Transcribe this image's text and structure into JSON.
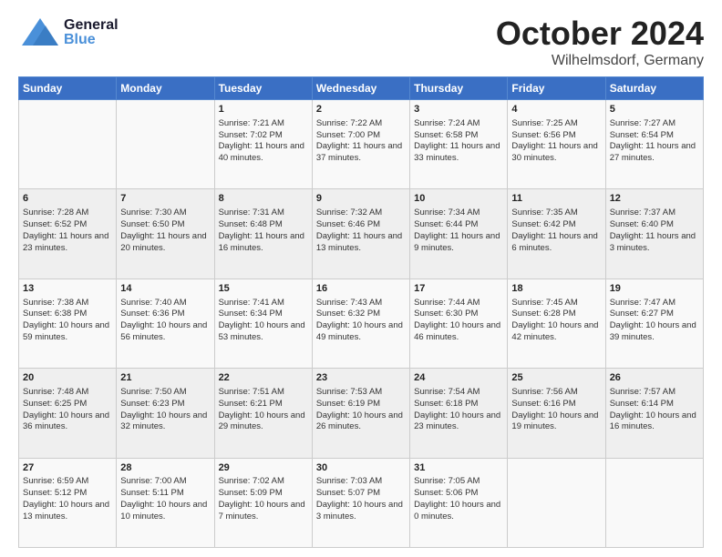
{
  "header": {
    "title": "October 2024",
    "subtitle": "Wilhelmsdorf, Germany",
    "logo_general": "General",
    "logo_blue": "Blue"
  },
  "weekdays": [
    "Sunday",
    "Monday",
    "Tuesday",
    "Wednesday",
    "Thursday",
    "Friday",
    "Saturday"
  ],
  "weeks": [
    [
      {
        "day": "",
        "content": ""
      },
      {
        "day": "",
        "content": ""
      },
      {
        "day": "1",
        "content": "Sunrise: 7:21 AM\nSunset: 7:02 PM\nDaylight: 11 hours and 40 minutes."
      },
      {
        "day": "2",
        "content": "Sunrise: 7:22 AM\nSunset: 7:00 PM\nDaylight: 11 hours and 37 minutes."
      },
      {
        "day": "3",
        "content": "Sunrise: 7:24 AM\nSunset: 6:58 PM\nDaylight: 11 hours and 33 minutes."
      },
      {
        "day": "4",
        "content": "Sunrise: 7:25 AM\nSunset: 6:56 PM\nDaylight: 11 hours and 30 minutes."
      },
      {
        "day": "5",
        "content": "Sunrise: 7:27 AM\nSunset: 6:54 PM\nDaylight: 11 hours and 27 minutes."
      }
    ],
    [
      {
        "day": "6",
        "content": "Sunrise: 7:28 AM\nSunset: 6:52 PM\nDaylight: 11 hours and 23 minutes."
      },
      {
        "day": "7",
        "content": "Sunrise: 7:30 AM\nSunset: 6:50 PM\nDaylight: 11 hours and 20 minutes."
      },
      {
        "day": "8",
        "content": "Sunrise: 7:31 AM\nSunset: 6:48 PM\nDaylight: 11 hours and 16 minutes."
      },
      {
        "day": "9",
        "content": "Sunrise: 7:32 AM\nSunset: 6:46 PM\nDaylight: 11 hours and 13 minutes."
      },
      {
        "day": "10",
        "content": "Sunrise: 7:34 AM\nSunset: 6:44 PM\nDaylight: 11 hours and 9 minutes."
      },
      {
        "day": "11",
        "content": "Sunrise: 7:35 AM\nSunset: 6:42 PM\nDaylight: 11 hours and 6 minutes."
      },
      {
        "day": "12",
        "content": "Sunrise: 7:37 AM\nSunset: 6:40 PM\nDaylight: 11 hours and 3 minutes."
      }
    ],
    [
      {
        "day": "13",
        "content": "Sunrise: 7:38 AM\nSunset: 6:38 PM\nDaylight: 10 hours and 59 minutes."
      },
      {
        "day": "14",
        "content": "Sunrise: 7:40 AM\nSunset: 6:36 PM\nDaylight: 10 hours and 56 minutes."
      },
      {
        "day": "15",
        "content": "Sunrise: 7:41 AM\nSunset: 6:34 PM\nDaylight: 10 hours and 53 minutes."
      },
      {
        "day": "16",
        "content": "Sunrise: 7:43 AM\nSunset: 6:32 PM\nDaylight: 10 hours and 49 minutes."
      },
      {
        "day": "17",
        "content": "Sunrise: 7:44 AM\nSunset: 6:30 PM\nDaylight: 10 hours and 46 minutes."
      },
      {
        "day": "18",
        "content": "Sunrise: 7:45 AM\nSunset: 6:28 PM\nDaylight: 10 hours and 42 minutes."
      },
      {
        "day": "19",
        "content": "Sunrise: 7:47 AM\nSunset: 6:27 PM\nDaylight: 10 hours and 39 minutes."
      }
    ],
    [
      {
        "day": "20",
        "content": "Sunrise: 7:48 AM\nSunset: 6:25 PM\nDaylight: 10 hours and 36 minutes."
      },
      {
        "day": "21",
        "content": "Sunrise: 7:50 AM\nSunset: 6:23 PM\nDaylight: 10 hours and 32 minutes."
      },
      {
        "day": "22",
        "content": "Sunrise: 7:51 AM\nSunset: 6:21 PM\nDaylight: 10 hours and 29 minutes."
      },
      {
        "day": "23",
        "content": "Sunrise: 7:53 AM\nSunset: 6:19 PM\nDaylight: 10 hours and 26 minutes."
      },
      {
        "day": "24",
        "content": "Sunrise: 7:54 AM\nSunset: 6:18 PM\nDaylight: 10 hours and 23 minutes."
      },
      {
        "day": "25",
        "content": "Sunrise: 7:56 AM\nSunset: 6:16 PM\nDaylight: 10 hours and 19 minutes."
      },
      {
        "day": "26",
        "content": "Sunrise: 7:57 AM\nSunset: 6:14 PM\nDaylight: 10 hours and 16 minutes."
      }
    ],
    [
      {
        "day": "27",
        "content": "Sunrise: 6:59 AM\nSunset: 5:12 PM\nDaylight: 10 hours and 13 minutes."
      },
      {
        "day": "28",
        "content": "Sunrise: 7:00 AM\nSunset: 5:11 PM\nDaylight: 10 hours and 10 minutes."
      },
      {
        "day": "29",
        "content": "Sunrise: 7:02 AM\nSunset: 5:09 PM\nDaylight: 10 hours and 7 minutes."
      },
      {
        "day": "30",
        "content": "Sunrise: 7:03 AM\nSunset: 5:07 PM\nDaylight: 10 hours and 3 minutes."
      },
      {
        "day": "31",
        "content": "Sunrise: 7:05 AM\nSunset: 5:06 PM\nDaylight: 10 hours and 0 minutes."
      },
      {
        "day": "",
        "content": ""
      },
      {
        "day": "",
        "content": ""
      }
    ]
  ]
}
